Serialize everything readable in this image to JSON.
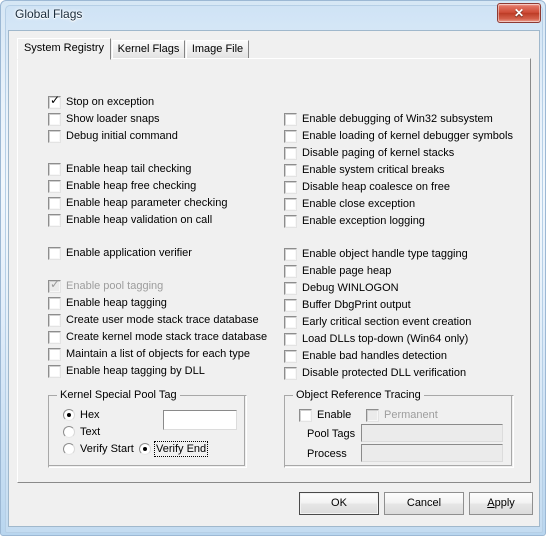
{
  "window": {
    "title": "Global Flags",
    "close_glyph": "✕",
    "close_label": "Close"
  },
  "tabs": [
    {
      "label": "System Registry",
      "active": true
    },
    {
      "label": "Kernel Flags",
      "active": false
    },
    {
      "label": "Image File",
      "active": false
    }
  ],
  "left_column": [
    {
      "label": "Stop on exception",
      "checked": true,
      "disabled": false
    },
    {
      "label": "Show loader snaps",
      "checked": false,
      "disabled": false
    },
    {
      "label": "Debug initial command",
      "checked": false,
      "disabled": false
    },
    {
      "label": "Enable heap tail checking",
      "checked": false,
      "disabled": false
    },
    {
      "label": "Enable heap free checking",
      "checked": false,
      "disabled": false
    },
    {
      "label": "Enable heap parameter checking",
      "checked": false,
      "disabled": false
    },
    {
      "label": "Enable heap validation on call",
      "checked": false,
      "disabled": false
    },
    {
      "label": "Enable application verifier",
      "checked": false,
      "disabled": false
    },
    {
      "label": "Enable pool tagging",
      "checked": true,
      "disabled": true
    },
    {
      "label": "Enable heap tagging",
      "checked": false,
      "disabled": false
    },
    {
      "label": "Create user mode stack trace database",
      "checked": false,
      "disabled": false
    },
    {
      "label": "Create kernel mode stack trace database",
      "checked": false,
      "disabled": false
    },
    {
      "label": "Maintain a list of objects for each type",
      "checked": false,
      "disabled": false
    },
    {
      "label": "Enable heap tagging by DLL",
      "checked": false,
      "disabled": false
    }
  ],
  "right_column": [
    {
      "label": "Enable debugging of Win32 subsystem",
      "checked": false,
      "disabled": false
    },
    {
      "label": "Enable loading of kernel debugger symbols",
      "checked": false,
      "disabled": false
    },
    {
      "label": "Disable paging of kernel stacks",
      "checked": false,
      "disabled": false
    },
    {
      "label": "Enable system critical breaks",
      "checked": false,
      "disabled": false
    },
    {
      "label": "Disable heap coalesce on free",
      "checked": false,
      "disabled": false
    },
    {
      "label": "Enable close exception",
      "checked": false,
      "disabled": false
    },
    {
      "label": "Enable exception logging",
      "checked": false,
      "disabled": false
    },
    {
      "label": "Enable object handle type tagging",
      "checked": false,
      "disabled": false
    },
    {
      "label": "Enable page heap",
      "checked": false,
      "disabled": false
    },
    {
      "label": "Debug WINLOGON",
      "checked": false,
      "disabled": false
    },
    {
      "label": "Buffer DbgPrint output",
      "checked": false,
      "disabled": false
    },
    {
      "label": "Early critical section event creation",
      "checked": false,
      "disabled": false
    },
    {
      "label": "Load DLLs top-down (Win64 only)",
      "checked": false,
      "disabled": false
    },
    {
      "label": "Enable bad handles detection",
      "checked": false,
      "disabled": false
    },
    {
      "label": "Disable protected DLL verification",
      "checked": false,
      "disabled": false
    }
  ],
  "kernel_pool_group": {
    "title": "Kernel Special Pool Tag",
    "format_options": [
      {
        "label": "Hex",
        "selected": true
      },
      {
        "label": "Text",
        "selected": false
      },
      {
        "label": "Verify Start",
        "selected": false
      }
    ],
    "verify_end": {
      "label": "Verify End",
      "selected": true,
      "focused": true
    },
    "tag_value": "",
    "tag_placeholder": ""
  },
  "object_tracing_group": {
    "title": "Object Reference Tracing",
    "enable": {
      "label": "Enable",
      "checked": false,
      "disabled": false
    },
    "permanent": {
      "label": "Permanent",
      "checked": false,
      "disabled": true
    },
    "pool_tags_label": "Pool Tags",
    "pool_tags_value": "",
    "process_label": "Process",
    "process_value": ""
  },
  "buttons": {
    "ok": "OK",
    "cancel": "Cancel",
    "apply_prefix": "A",
    "apply_rest": "pply"
  }
}
